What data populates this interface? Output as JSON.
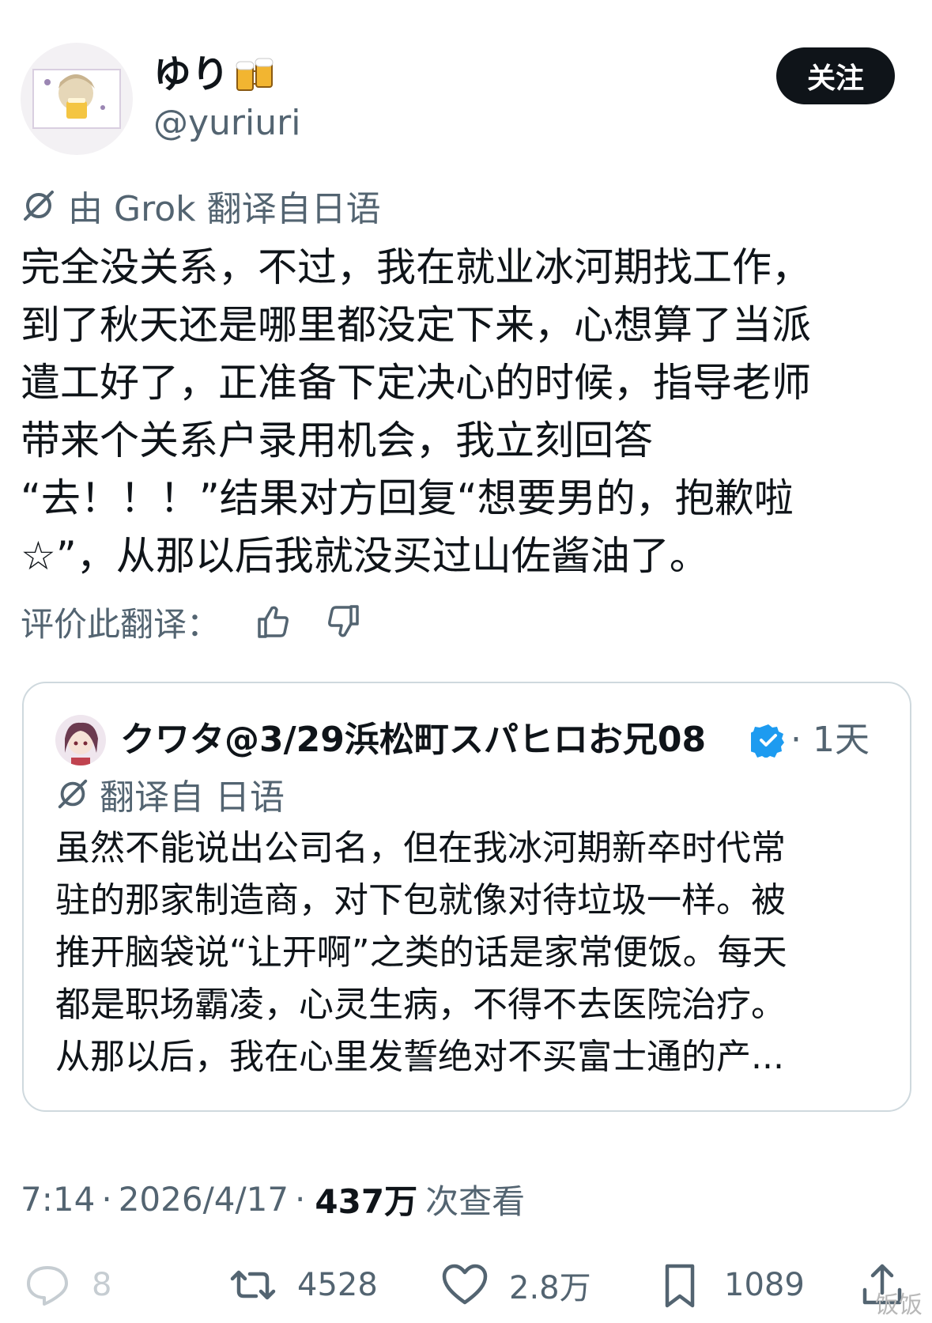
{
  "author": {
    "display_name": "ゆり",
    "handle": "@yuriuri"
  },
  "follow_button": "关注",
  "translation": {
    "label": "由 Grok 翻译自日语",
    "rate_label": "评价此翻译："
  },
  "post_body": [
    "完全没关系，不过，我在就业冰河期找工作，",
    "到了秋天还是哪里都没定下来，心想算了当派",
    "遣工好了，正准备下定决心的时候，指导老师",
    "带来个关系户录用机会，我立刻回答",
    "“去！！！”结果对方回复“想要男的，抱歉啦",
    "☆”，从那以后我就没买过山佐酱油了。"
  ],
  "quote": {
    "name": "クワタ@3/29浜松町スパヒロお兄08",
    "time": "· 1天",
    "translated_label": "翻译自 日语",
    "body": [
      "虽然不能说出公司名，但在我冰河期新卒时代常",
      "驻的那家制造商，对下包就像对待垃圾一样。被",
      "推开脑袋说“让开啊”之类的话是家常便饭。每天",
      "都是职场霸凌，心灵生病，不得不去医院治疗。",
      "从那以后，我在心里发誓绝对不买富士通的产..."
    ]
  },
  "meta": {
    "time": "7:14",
    "date": "2026/4/17",
    "views": "437万",
    "views_label": "次查看",
    "separator": "·"
  },
  "actions": {
    "replies": "8",
    "retweets": "4528",
    "likes": "2.8万",
    "bookmarks": "1089"
  },
  "watermark": "饭饭",
  "colors": {
    "text": "#0f1419",
    "secondary": "#536471",
    "border": "#cfd9de",
    "verified": "#1d9bf0",
    "follow_bg": "#0f1419"
  }
}
